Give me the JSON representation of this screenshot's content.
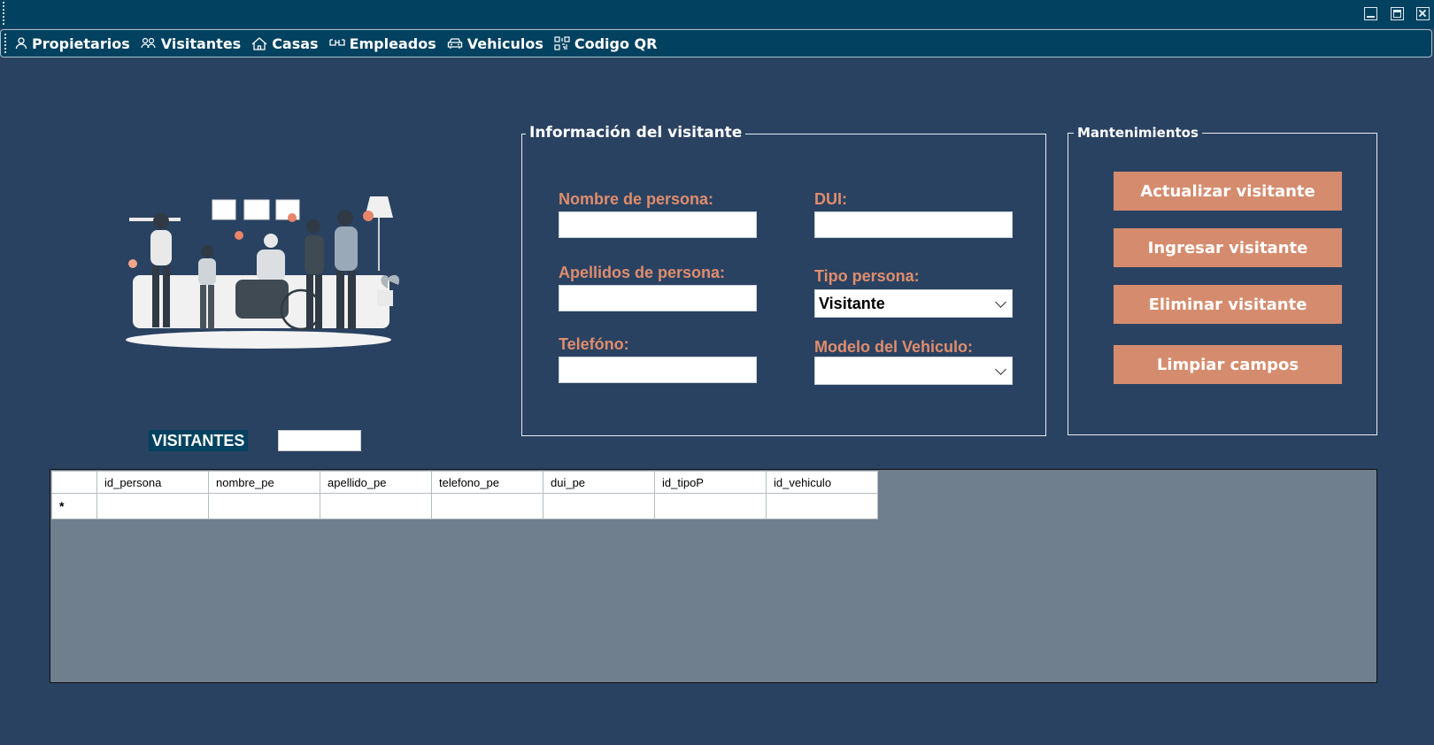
{
  "window": {
    "controls": [
      "minimize-icon",
      "maximize-icon",
      "close-icon"
    ]
  },
  "menu": {
    "items": [
      {
        "label": "Propietarios",
        "icon": "person-icon"
      },
      {
        "label": "Visitantes",
        "icon": "people-icon"
      },
      {
        "label": "Casas",
        "icon": "house-icon"
      },
      {
        "label": "Empleados",
        "icon": "glasses-icon"
      },
      {
        "label": "Vehiculos",
        "icon": "car-icon"
      },
      {
        "label": "Codigo QR",
        "icon": "qr-icon"
      }
    ]
  },
  "list": {
    "badge": "VISITANTES",
    "search_value": ""
  },
  "info_group": {
    "legend": "Información del visitante",
    "fields": {
      "nombre_label": "Nombre de persona:",
      "nombre_value": "",
      "dui_label": "DUI:",
      "dui_value": "",
      "apellidos_label": "Apellidos de persona:",
      "apellidos_value": "",
      "tipo_label": "Tipo persona:",
      "tipo_selected": "Visitante",
      "telefono_label": "Telefóno:",
      "telefono_value": "",
      "modelo_label": "Modelo del Vehiculo:",
      "modelo_selected": ""
    }
  },
  "maint_group": {
    "legend": "Mantenimientos",
    "buttons": {
      "actualizar": "Actualizar visitante",
      "ingresar": "Ingresar visitante",
      "eliminar": "Eliminar visitante",
      "limpiar": "Limpiar campos"
    }
  },
  "grid": {
    "columns": [
      "id_persona",
      "nombre_pe",
      "apellido_pe",
      "telefono_pe",
      "dui_pe",
      "id_tipoP",
      "id_vehiculo"
    ],
    "new_row_marker": "*"
  },
  "colors": {
    "background": "#2a4261",
    "titlebar": "#02415f",
    "accent": "#d58c6e",
    "label": "#df8d6d",
    "grid_bg": "#6f7f8e"
  }
}
